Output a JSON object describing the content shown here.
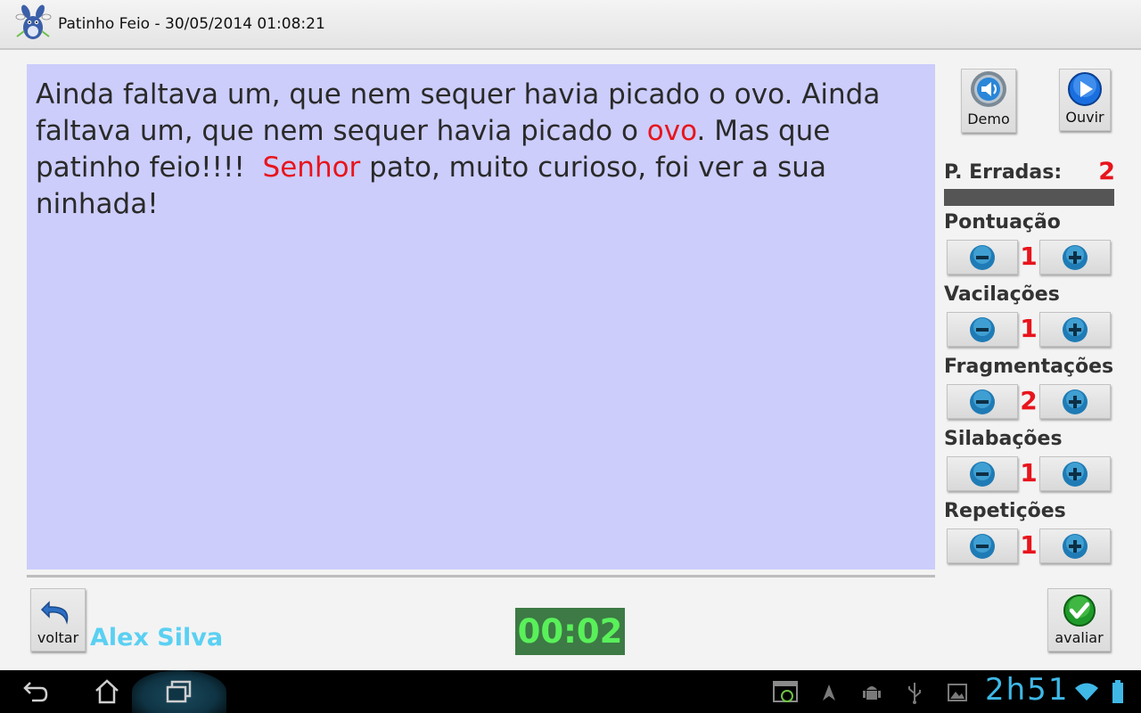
{
  "window": {
    "title": "Patinho Feio - 30/05/2014 01:08:21",
    "app_icon": "bunny-mascot-icon"
  },
  "reading": {
    "segments": [
      {
        "text": "Ainda faltava um, que nem sequer havia picado o ovo. Ainda faltava um, que nem sequer havia picado o ",
        "error": false
      },
      {
        "text": "ovo",
        "error": true
      },
      {
        "text": ". Mas que patinho feio!!!!  ",
        "error": false
      },
      {
        "text": "Senhor",
        "error": true
      },
      {
        "text": " pato, muito curioso, foi ver a sua ninhada!",
        "error": false
      }
    ],
    "panel_color": "#cccdfb",
    "error_color": "#e8141c"
  },
  "toolbar": {
    "demo_label": "Demo",
    "demo_icon": "speaker-icon",
    "ouvir_label": "Ouvir",
    "ouvir_icon": "play-icon"
  },
  "stats": {
    "errors_label": "P. Erradas:",
    "errors_value": "2",
    "counters": [
      {
        "label": "Pontuação",
        "value": "1"
      },
      {
        "label": "Vacilações",
        "value": "1"
      },
      {
        "label": "Fragmentações",
        "value": "2"
      },
      {
        "label": "Silabações",
        "value": "1"
      },
      {
        "label": "Repetições",
        "value": "1"
      }
    ]
  },
  "footer": {
    "back_label": "voltar",
    "back_icon": "undo-arrow-icon",
    "user_name": "Alex Silva",
    "timer": "00:02",
    "evaluate_label": "avaliar",
    "evaluate_icon": "checkmark-icon"
  },
  "system_bar": {
    "clock": "2h51",
    "icons": [
      "back-icon",
      "home-icon",
      "recent-apps-icon",
      "screenshot-icon",
      "location-icon",
      "android-debug-icon",
      "usb-icon",
      "gallery-icon",
      "wifi-icon",
      "battery-icon"
    ]
  }
}
